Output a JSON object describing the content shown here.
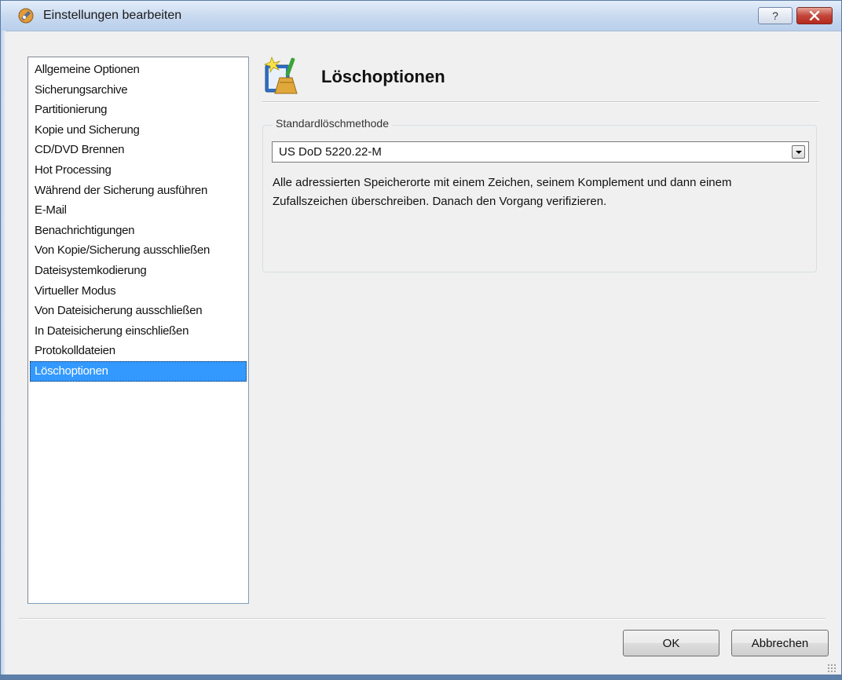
{
  "window": {
    "title": "Einstellungen bearbeiten",
    "help_label": "?",
    "close_label": "✕"
  },
  "options": {
    "items": [
      "Allgemeine Optionen",
      "Sicherungsarchive",
      "Partitionierung",
      "Kopie und Sicherung",
      "CD/DVD Brennen",
      "Hot Processing",
      "Während der Sicherung ausführen",
      "E-Mail",
      "Benachrichtigungen",
      "Von Kopie/Sicherung ausschließen",
      "Dateisystemkodierung",
      "Virtueller Modus",
      "Von Dateisicherung ausschließen",
      "In Dateisicherung einschließen",
      "Protokolldateien",
      "Löschoptionen"
    ],
    "selected_index": 15
  },
  "panel": {
    "title": "Löschoptionen",
    "group_label": "Standardlöschmethode",
    "method_value": "US DoD 5220.22-M",
    "description": "Alle adressierten Speicherorte mit einem Zeichen, seinem Komplement und dann einem Zufallszeichen überschreiben. Danach den Vorgang verifizieren."
  },
  "buttons": {
    "ok_label": "OK",
    "cancel_label": "Abbrechen"
  },
  "colors": {
    "selection": "#3399ff",
    "title_bar": "#c9daf0",
    "close_button": "#c3453a"
  }
}
